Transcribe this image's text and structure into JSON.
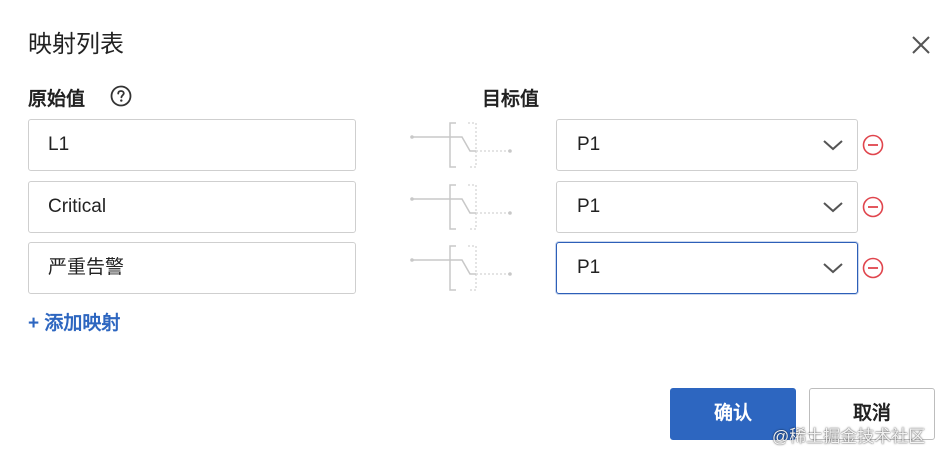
{
  "dialog": {
    "title": "映射列表",
    "close_icon": "close-icon"
  },
  "columns": {
    "source_label": "原始值",
    "source_help_icon": "question-circle-icon",
    "target_label": "目标值"
  },
  "mappings": [
    {
      "source_value": "L1",
      "target_value": "P1",
      "focused": false
    },
    {
      "source_value": "Critical",
      "target_value": "P1",
      "focused": false
    },
    {
      "source_value": "严重告警",
      "target_value": "P1",
      "focused": true
    }
  ],
  "add_mapping_label": "+ 添加映射",
  "footer": {
    "confirm_label": "确认",
    "cancel_label": "取消"
  },
  "watermark": "@稀土掘金技术社区",
  "colors": {
    "primary": "#2d66c0",
    "remove": "#e0454d",
    "border": "#cfcfcf",
    "connector": "#c8c8c8"
  }
}
